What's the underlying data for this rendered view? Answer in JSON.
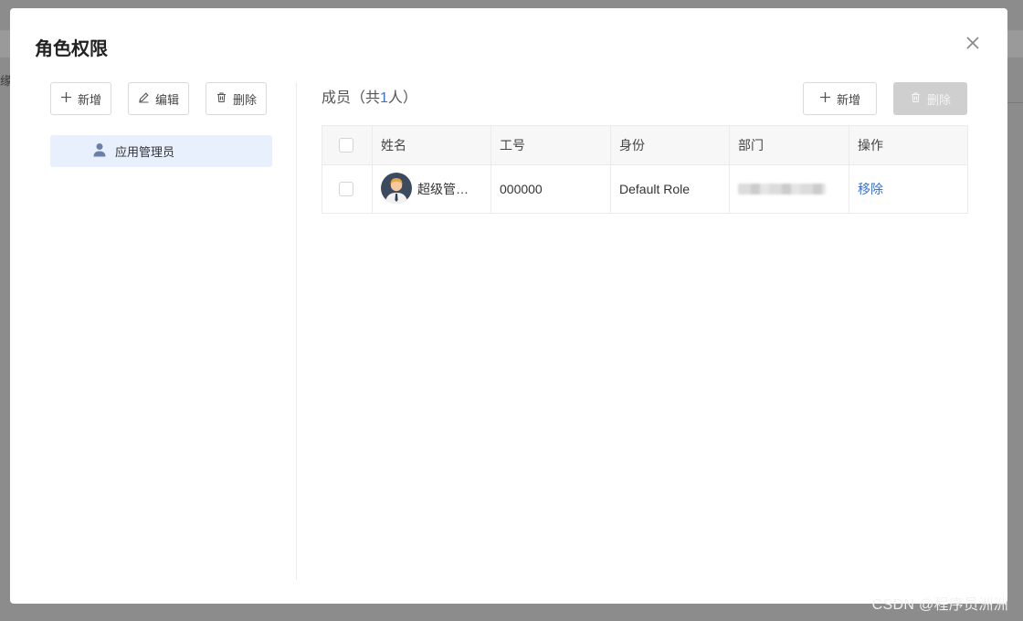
{
  "background": {
    "partial_char": "缘"
  },
  "watermark": "CSDN @程序员洲洲",
  "dialog": {
    "title": "角色权限",
    "close_icon": "close-icon",
    "left": {
      "buttons": [
        {
          "label": "新增",
          "icon": "plus-icon"
        },
        {
          "label": "编辑",
          "icon": "edit-icon"
        },
        {
          "label": "删除",
          "icon": "trash-icon"
        }
      ],
      "roles": [
        {
          "label": "应用管理员",
          "icon": "user-icon",
          "selected": true
        }
      ]
    },
    "right": {
      "title_prefix": "成员（共",
      "count": "1",
      "title_suffix": "人）",
      "add_button": "新增",
      "delete_button": "删除",
      "table": {
        "columns": [
          "姓名",
          "工号",
          "身份",
          "部门",
          "操作"
        ],
        "rows": [
          {
            "name": "超级管…",
            "employee_id": "000000",
            "identity": "Default Role",
            "department": "",
            "action": "移除"
          }
        ]
      }
    }
  },
  "colors": {
    "accent": "#3a6fd8",
    "selected_bg": "#e8effd",
    "disabled_bg": "#cfcfcf"
  }
}
